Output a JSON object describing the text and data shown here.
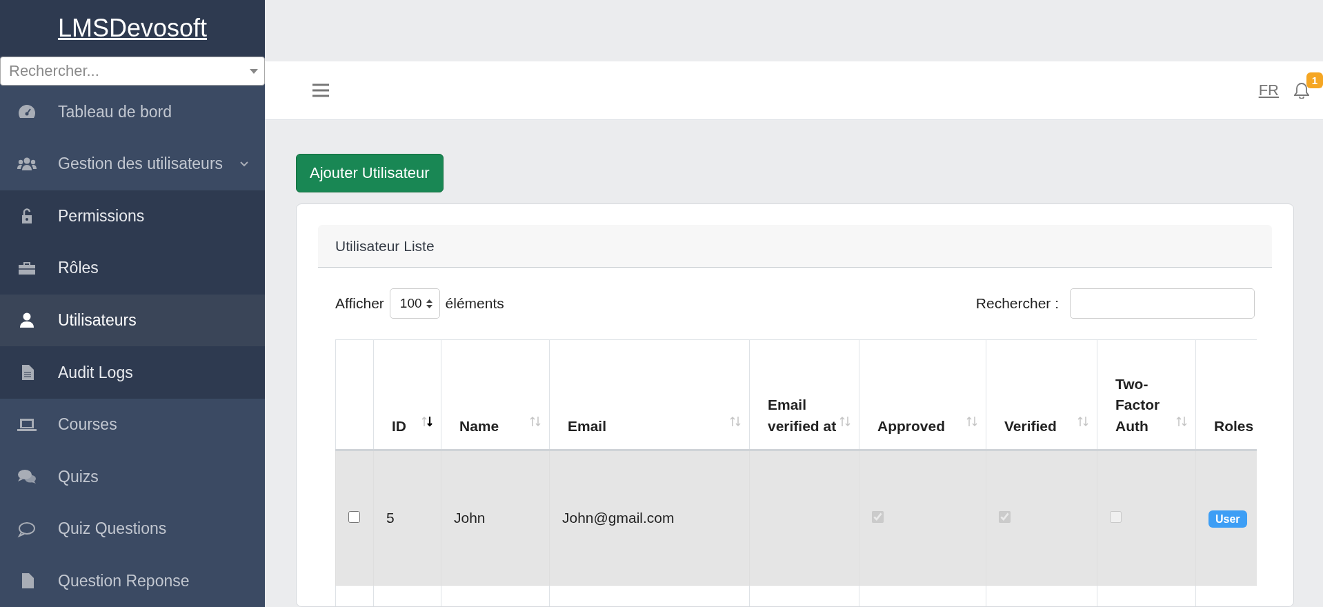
{
  "sidebar": {
    "brand": "LMSDevosoft",
    "search": {
      "placeholder": "Rechercher..."
    },
    "items": [
      {
        "label": "Tableau de bord",
        "selected": false
      },
      {
        "label": "Gestion des utilisateurs",
        "selected": false,
        "expanded": true,
        "children": [
          {
            "label": "Permissions",
            "selected": false
          },
          {
            "label": "Rôles",
            "selected": false
          },
          {
            "label": "Utilisateurs",
            "selected": true
          },
          {
            "label": "Audit Logs",
            "selected": false
          }
        ]
      },
      {
        "label": "Courses",
        "selected": false
      },
      {
        "label": "Quizs",
        "selected": false
      },
      {
        "label": "Quiz Questions",
        "selected": false
      },
      {
        "label": "Question Reponse",
        "selected": false
      }
    ]
  },
  "header": {
    "language": "FR",
    "notification_count": "1"
  },
  "add_button": "Ajouter Utilisateur",
  "card": {
    "title": "Utilisateur Liste",
    "length": {
      "label_before": "Afficher",
      "value": "100",
      "label_after": "éléments"
    },
    "search": {
      "label": "Rechercher :"
    },
    "table": {
      "columns": [
        {},
        {
          "label": "ID",
          "sorted": true
        },
        {
          "label": "Name",
          "sorted": false
        },
        {
          "label": "Email",
          "sorted": false
        },
        {
          "label": "Email verified at",
          "sorted": false
        },
        {
          "label": "Approved",
          "sorted": false
        },
        {
          "label": "Verified",
          "sorted": false
        },
        {
          "label": "Two-Factor Auth",
          "sorted": false
        },
        {
          "label": "Roles"
        }
      ],
      "rows": [
        {
          "checked": false,
          "id": "5",
          "name": "John",
          "email": "John@gmail.com",
          "approved": true,
          "verified": true,
          "two_factor": false,
          "roles": [
            "User"
          ]
        }
      ]
    }
  }
}
